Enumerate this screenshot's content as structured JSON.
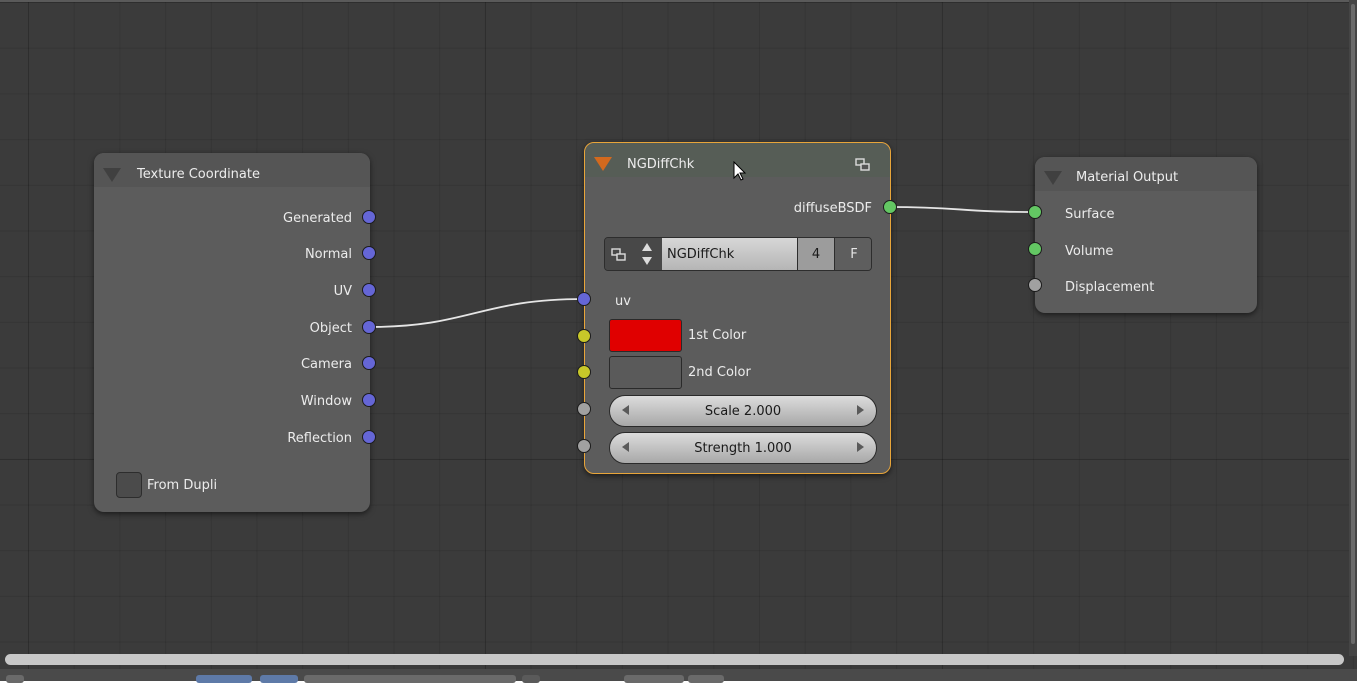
{
  "colors": {
    "background": "#3b3b3b",
    "node_body": "#5c5c5c",
    "group_border": "#e8a53a",
    "socket_vector": "#6566d6",
    "socket_shader": "#63c763",
    "socket_color": "#c7c729",
    "socket_float": "#a1a1a1",
    "first_color_value": "#e00000",
    "second_color_value": "#5a5a5a"
  },
  "texture_coordinate": {
    "title": "Texture Coordinate",
    "outputs": [
      "Generated",
      "Normal",
      "UV",
      "Object",
      "Camera",
      "Window",
      "Reflection"
    ],
    "from_dupli_label": "From Dupli",
    "from_dupli_checked": false
  },
  "group_node": {
    "title": "NGDiffChk",
    "output_label": "diffuseBSDF",
    "datablock_name": "NGDiffChk",
    "user_count": "4",
    "fake_user": "F",
    "uv_label": "uv",
    "color1_label": "1st Color",
    "color2_label": "2nd Color",
    "scale_text": "Scale 2.000",
    "strength_text": "Strength 1.000",
    "scale": 2.0,
    "strength": 1.0
  },
  "material_output": {
    "title": "Material Output",
    "inputs": [
      "Surface",
      "Volume",
      "Displacement"
    ]
  },
  "icons": {
    "collapse": "triangle-down-icon",
    "group": "node-group-icon",
    "cursor": "mouse-pointer-icon"
  }
}
